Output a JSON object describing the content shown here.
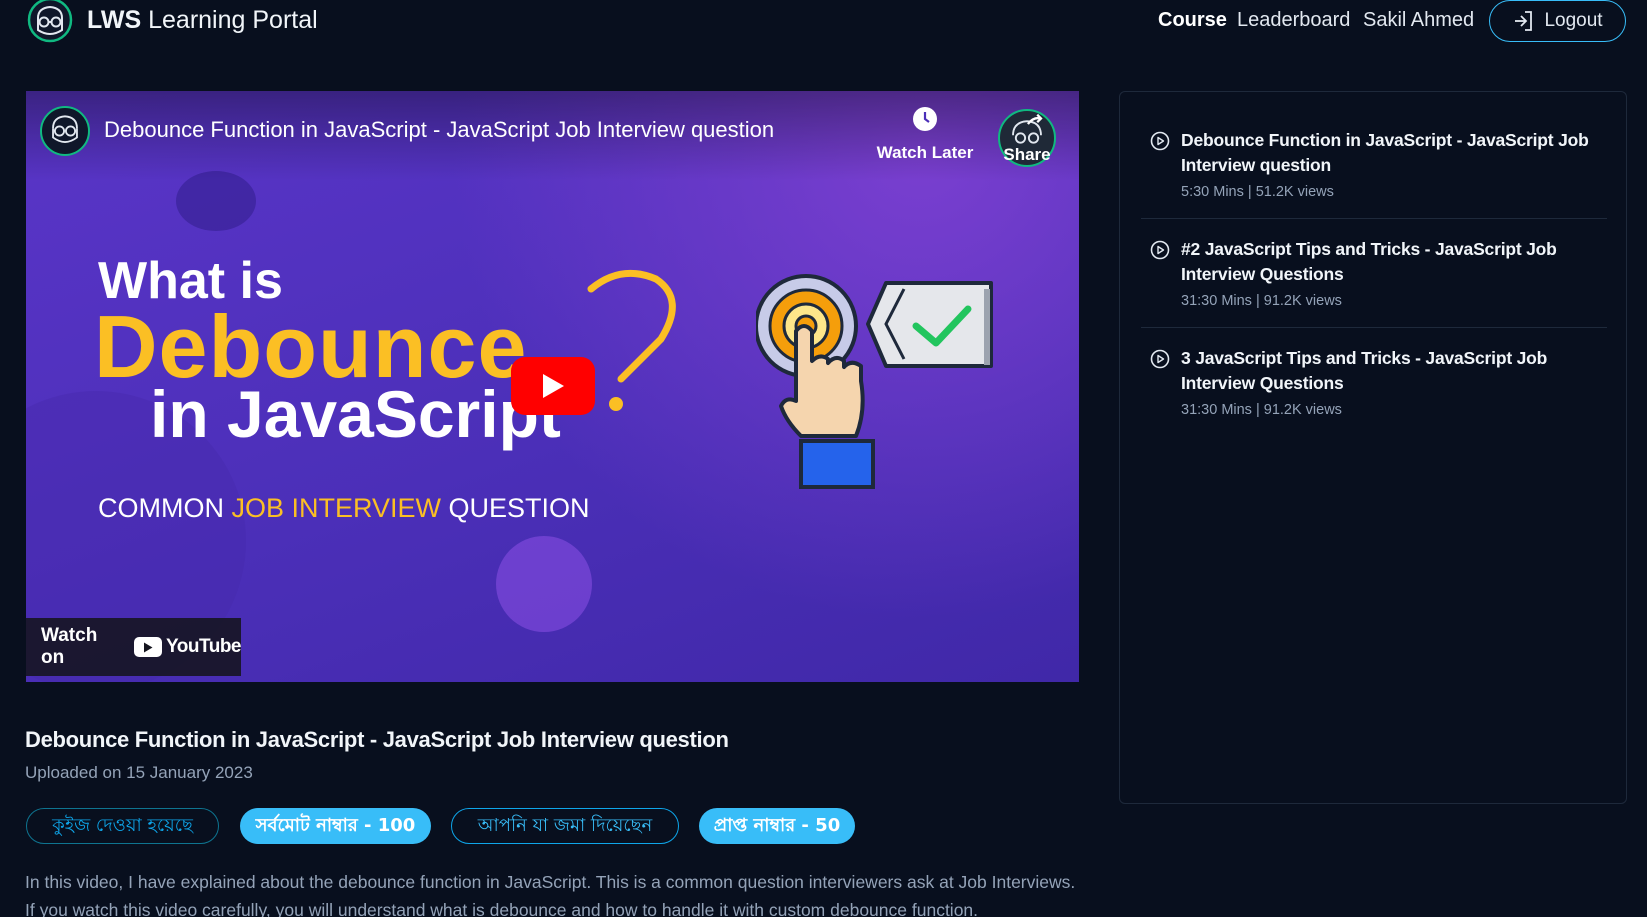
{
  "header": {
    "brand_bold": "LWS",
    "brand_rest": " Learning Portal",
    "nav": [
      "Course",
      "Leaderboard",
      "Sakil Ahmed"
    ],
    "logout_label": "Logout"
  },
  "video": {
    "title": "Debounce Function in JavaScript - JavaScript Job Interview question",
    "watch_later_label": "Watch Later",
    "share_label": "Share",
    "thumb_line1": "What is",
    "thumb_line2": "Debounce",
    "thumb_line3": "in JavaScript",
    "thumb_common_a": "COMMON ",
    "thumb_common_b": "JOB INTERVIEW",
    "thumb_common_c": " QUESTION",
    "watch_on_label": "Watch on",
    "youtube_label": "YouTube"
  },
  "details": {
    "title": "Debounce Function in JavaScript - JavaScript Job Interview question",
    "uploaded": "Uploaded on 15 January 2023",
    "badges": [
      "কুইজ দেওয়া হয়েছে",
      "সর্বমোট নাম্বার - 100",
      "আপনি যা জমা দিয়েছেন",
      "প্রাপ্ত নাম্বার - 50"
    ],
    "description": "In this video, I have explained about the debounce function in JavaScript. This is a common question interviewers ask at Job Interviews. If you watch this video carefully, you will understand what is debounce and how to handle it with custom debounce function."
  },
  "playlist": [
    {
      "title": "Debounce Function in JavaScript - JavaScript Job Interview question",
      "meta": "5:30 Mins | 51.2K views"
    },
    {
      "title": "#2 JavaScript Tips and Tricks - JavaScript Job Interview Questions",
      "meta": "31:30 Mins | 91.2K views"
    },
    {
      "title": "3 JavaScript Tips and Tricks - JavaScript Job Interview Questions",
      "meta": "31:30 Mins | 91.2K views"
    }
  ],
  "colors": {
    "background": "#080f1e",
    "accent": "#38bdf8",
    "thumbnail_purple": "#4b2fb8",
    "thumbnail_yellow": "#fbbf24",
    "play_red": "#ff0000"
  }
}
